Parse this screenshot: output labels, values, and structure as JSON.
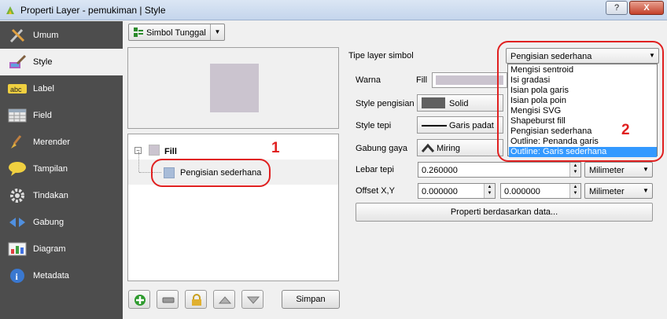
{
  "window": {
    "title": "Properti Layer - pemukiman | Style",
    "help_label": "?",
    "close_label": "X"
  },
  "sidebar": {
    "items": [
      {
        "label": "Umum",
        "icon": "tools-icon"
      },
      {
        "label": "Style",
        "icon": "paintbrush-icon"
      },
      {
        "label": "Label",
        "icon": "abc-label-icon"
      },
      {
        "label": "Field",
        "icon": "table-icon"
      },
      {
        "label": "Merender",
        "icon": "brush-icon"
      },
      {
        "label": "Tampilan",
        "icon": "speech-bubble-icon"
      },
      {
        "label": "Tindakan",
        "icon": "gear-icon"
      },
      {
        "label": "Gabung",
        "icon": "join-arrow-icon"
      },
      {
        "label": "Diagram",
        "icon": "chart-icon"
      },
      {
        "label": "Metadata",
        "icon": "info-icon"
      }
    ],
    "active_index": 1
  },
  "renderer": {
    "label": "Simbol Tunggal"
  },
  "symbol_tree": {
    "fill_label": "Fill",
    "sublayer_label": "Pengisian sederhana",
    "expander": "−"
  },
  "annotations": {
    "one": "1",
    "two": "2"
  },
  "buttons": {
    "save": "Simpan"
  },
  "props": {
    "layer_type_label": "Tipe layer simbol",
    "layer_type_value": "Pengisian sederhana",
    "color_label": "Warna",
    "fill_label": "Fill",
    "fill_style_label": "Style pengisian",
    "fill_style_value": "Solid",
    "border_style_label": "Style tepi",
    "border_style_value": "Garis padat",
    "join_style_label": "Gabung gaya",
    "join_style_value": "Miring",
    "border_width_label": "Lebar tepi",
    "border_width_value": "0.260000",
    "border_width_unit": "Milimeter",
    "offset_label": "Offset X,Y",
    "offset_x": "0.000000",
    "offset_y": "0.000000",
    "offset_unit": "Milimeter",
    "data_defined": "Properti berdasarkan data..."
  },
  "dropdown": {
    "options": [
      "Mengisi sentroid",
      "Isi gradasi",
      "Isian pola garis",
      "Isian pola poin",
      "Mengisi SVG",
      "Shapeburst fill",
      "Pengisian sederhana",
      "Outline: Penanda garis",
      "Outline: Garis sederhana"
    ],
    "highlighted_index": 8
  },
  "colors": {
    "sidebar_bg": "#4d4d4d",
    "fill_color": "#cbc4cf",
    "annotation_red": "#e02020",
    "selection_blue": "#3399ff"
  }
}
